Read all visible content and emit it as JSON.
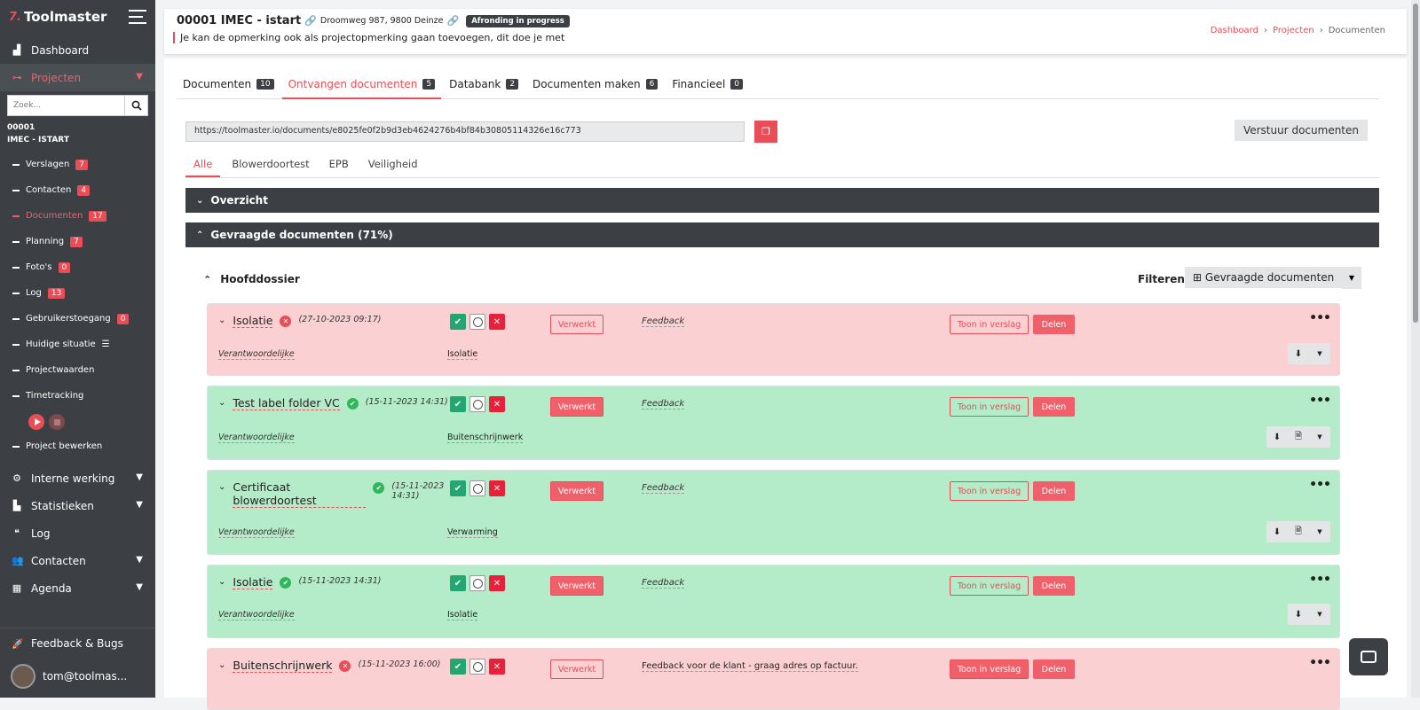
{
  "sidebar": {
    "brand": "Toolmaster",
    "brand_mark": "7.",
    "menu_top": [
      {
        "label": "Dashboard",
        "icon": "chart-icon"
      },
      {
        "label": "Projecten",
        "icon": "project-icon"
      }
    ],
    "search_placeholder": "Zoek...",
    "project_code": "00001",
    "project_name": "IMEC - ISTART",
    "sub_items": [
      {
        "label": "Verslagen",
        "badge": "7"
      },
      {
        "label": "Contacten",
        "badge": "4"
      },
      {
        "label": "Documenten",
        "badge": "17"
      },
      {
        "label": "Planning",
        "badge": "7"
      },
      {
        "label": "Foto's",
        "badge": "0"
      },
      {
        "label": "Log",
        "badge": "13"
      },
      {
        "label": "Gebruikerstoegang",
        "badge": "0"
      },
      {
        "label": "Huidige situatie",
        "badge": ""
      },
      {
        "label": "Projectwaarden",
        "badge": ""
      },
      {
        "label": "Timetracking",
        "badge": ""
      },
      {
        "label": "Project bewerken",
        "badge": ""
      }
    ],
    "menu_bottom": [
      {
        "label": "Interne werking"
      },
      {
        "label": "Statistieken"
      },
      {
        "label": "Log"
      },
      {
        "label": "Contacten"
      },
      {
        "label": "Agenda"
      }
    ],
    "feedback": "Feedback & Bugs",
    "user": "tom@toolmas..."
  },
  "header": {
    "title": "00001 IMEC - istart",
    "address": "Droomweg 987, 9800 Deinze",
    "status": "Afronding in progress",
    "remark": "Je kan de opmerking ook als projectopmerking gaan toevoegen, dit doe je met",
    "breadcrumb": [
      "Dashboard",
      "Projecten",
      "Documenten"
    ]
  },
  "tabs": [
    {
      "label": "Documenten",
      "count": "10"
    },
    {
      "label": "Ontvangen documenten",
      "count": "5"
    },
    {
      "label": "Databank",
      "count": "2"
    },
    {
      "label": "Documenten maken",
      "count": "6"
    },
    {
      "label": "Financieel",
      "count": "0"
    }
  ],
  "url": "https://toolmaster.io/documents/e8025fe0f2b9d3eb4624276b4bf84b30805114326e16c773",
  "send_label": "Verstuur documenten",
  "subtabs": [
    "Alle",
    "Blowerdoortest",
    "EPB",
    "Veiligheid"
  ],
  "sections": {
    "overview": "Overzicht",
    "requested": "Gevraagde documenten (71%)",
    "folder": "Hoofddossier",
    "filter_label": "Filteren",
    "requested_btn": "Gevraagde documenten"
  },
  "labels": {
    "verwerkt": "Verwerkt",
    "toon": "Toon in verslag",
    "delen": "Delen",
    "verantwoordelijke": "Verantwoordelijke",
    "feedback": "Feedback"
  },
  "documents": [
    {
      "name": "Isolatie",
      "status": "rejected",
      "date": "(27-10-2023 09:17)",
      "category": "Isolatie",
      "feedback": "Feedback",
      "color": "#fbd0d2"
    },
    {
      "name": "Test label folder VC",
      "status": "approved",
      "date": "(15-11-2023 14:31)",
      "category": "Buitenschrijnwerk",
      "feedback": "Feedback",
      "color": "#b4ebc8"
    },
    {
      "name": "Certificaat blowerdoortest",
      "status": "approved",
      "date": "(15-11-2023 14:31)",
      "category": "Verwarming",
      "feedback": "Feedback",
      "color": "#b4ebc8"
    },
    {
      "name": "Isolatie",
      "status": "approved",
      "date": "(15-11-2023 14:31)",
      "category": "Isolatie",
      "feedback": "Feedback",
      "color": "#b4ebc8"
    },
    {
      "name": "Buitenschrijnwerk",
      "status": "rejected",
      "date": "(15-11-2023 16:00)",
      "category": "",
      "feedback": "Feedback voor de klant - graag adres op factuur.",
      "color": "#fbd0d2"
    }
  ],
  "colors": {
    "accent": "#e94d55",
    "sidebar": "#3c4044"
  }
}
